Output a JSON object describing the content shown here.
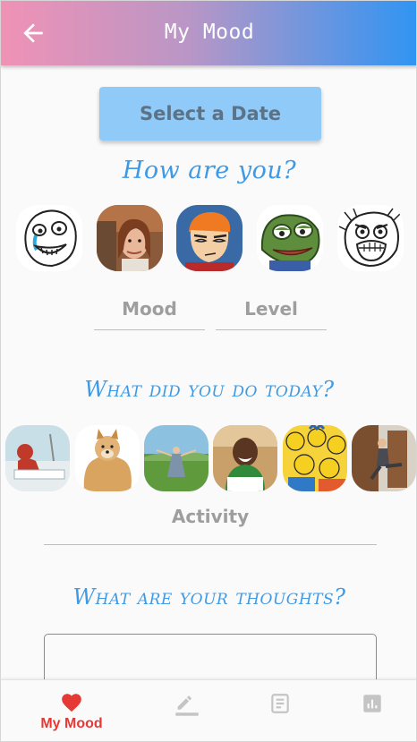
{
  "app_bar": {
    "title": "My Mood",
    "back_icon": "arrow-left-icon",
    "gradient_colors": [
      "#f092b5",
      "#2f95f3"
    ]
  },
  "date_picker": {
    "button_label": "Select a Date"
  },
  "mood_section": {
    "heading": "How are you?",
    "memes": [
      "crying-happy-rageface",
      "disaster-girl",
      "squinting-fry",
      "feels-good-frog",
      "rage-face"
    ],
    "fields": {
      "mood_label": "Mood",
      "level_label": "Level"
    }
  },
  "activity_section": {
    "heading": "What did you do today?",
    "memes": [
      "spiderman-hospital-bed",
      "buff-doge",
      "field-spin",
      "angry-kid-writing",
      "family-crowd-cartoon",
      "kicking-door"
    ],
    "field_label": "Activity"
  },
  "thoughts_section": {
    "heading": "What are your thoughts?",
    "input_value": ""
  },
  "bottom_nav": {
    "active_color": "#e53935",
    "inactive_color": "#bdbdbd",
    "items": [
      {
        "label": "My Mood",
        "icon": "heart-icon",
        "active": true
      },
      {
        "label": "",
        "icon": "pencil-icon",
        "active": false
      },
      {
        "label": "",
        "icon": "notes-icon",
        "active": false
      },
      {
        "label": "",
        "icon": "bar-chart-icon",
        "active": false
      }
    ]
  }
}
